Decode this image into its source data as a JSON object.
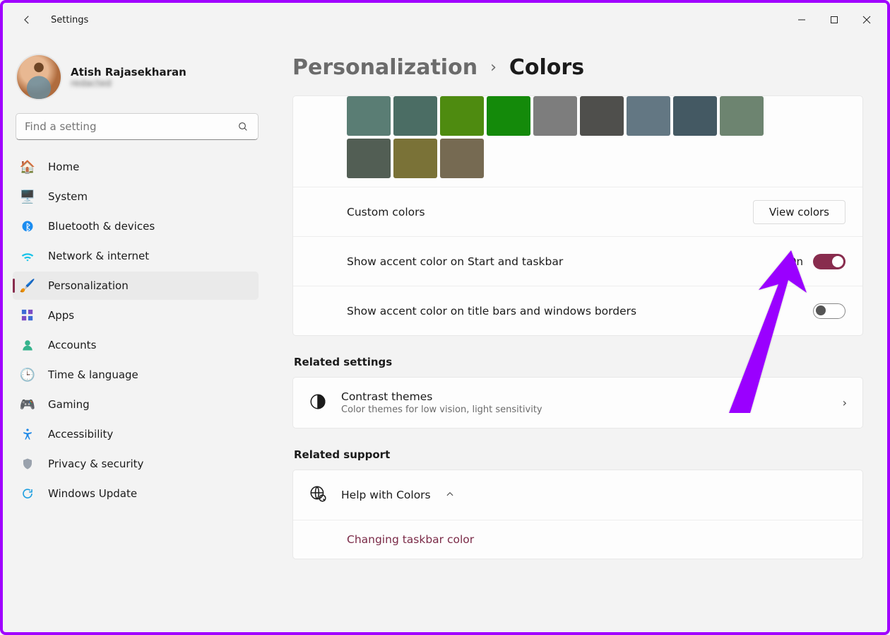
{
  "app_title": "Settings",
  "window_controls": {
    "minimize": "minimize",
    "maximize": "maximize",
    "close": "close"
  },
  "user": {
    "name": "Atish Rajasekharan",
    "email": "redacted"
  },
  "search": {
    "placeholder": "Find a setting"
  },
  "nav": {
    "items": [
      {
        "icon": "home-icon",
        "label": "Home"
      },
      {
        "icon": "system-icon",
        "label": "System"
      },
      {
        "icon": "bluetooth-icon",
        "label": "Bluetooth & devices"
      },
      {
        "icon": "network-icon",
        "label": "Network & internet"
      },
      {
        "icon": "personalization-icon",
        "label": "Personalization",
        "active": true
      },
      {
        "icon": "apps-icon",
        "label": "Apps"
      },
      {
        "icon": "accounts-icon",
        "label": "Accounts"
      },
      {
        "icon": "time-icon",
        "label": "Time & language"
      },
      {
        "icon": "gaming-icon",
        "label": "Gaming"
      },
      {
        "icon": "accessibility-icon",
        "label": "Accessibility"
      },
      {
        "icon": "privacy-icon",
        "label": "Privacy & security"
      },
      {
        "icon": "update-icon",
        "label": "Windows Update"
      }
    ]
  },
  "breadcrumb": {
    "parent": "Personalization",
    "current": "Colors"
  },
  "swatches": {
    "row1": [
      "#5a7d74",
      "#4b6d64",
      "#4e8b10",
      "#148a0a",
      "#7d7d7d",
      "#4f4f4c",
      "#637783",
      "#445963",
      "#6d8470"
    ],
    "row2": [
      "#525e54",
      "#7a7237",
      "#766a52"
    ]
  },
  "rows": {
    "custom_colors": {
      "label": "Custom colors",
      "button": "View colors"
    },
    "accent_start": {
      "label": "Show accent color on Start and taskbar",
      "state": "On",
      "on": true
    },
    "accent_title": {
      "label": "Show accent color on title bars and windows borders",
      "on": false
    }
  },
  "related_settings": {
    "heading": "Related settings",
    "contrast": {
      "title": "Contrast themes",
      "sub": "Color themes for low vision, light sensitivity"
    }
  },
  "related_support": {
    "heading": "Related support",
    "help": {
      "title": "Help with Colors"
    },
    "link": "Changing taskbar color"
  }
}
